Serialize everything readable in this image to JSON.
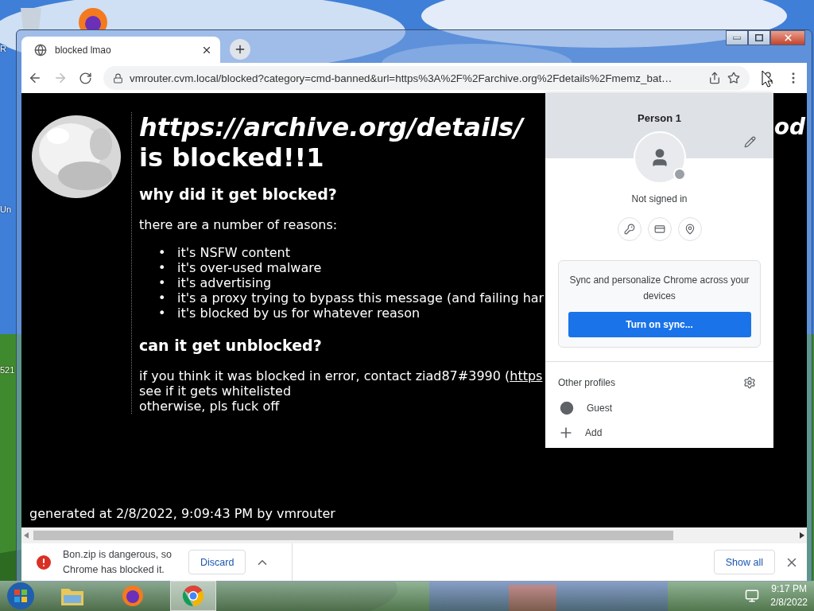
{
  "desktop": {
    "icon_labels": [
      "R",
      "Un",
      "521"
    ]
  },
  "browser": {
    "tabs": [
      {
        "title": "blocked lmao",
        "selected": true
      }
    ],
    "back_disabled": false,
    "forward_disabled": true,
    "address": "vmrouter.cvm.local/blocked?category=cmd-banned&url=https%3A%2F%2Farchive.org%2Fdetails%2Fmemz_bat…"
  },
  "page": {
    "heading_url": "https://archive.org/details/",
    "heading_url_tail": "od",
    "heading_rest": "is blocked!!1",
    "section_1": "why did it get blocked?",
    "intro": "there are a number of reasons:",
    "bullet": "•",
    "reasons": [
      "it's NSFW content",
      "it's over-used malware",
      "it's advertising",
      "it's a proxy trying to bypass this message (and failing har",
      "it's blocked by us for whatever reason"
    ],
    "section_2": "can it get unblocked?",
    "contact_text": "if you think it was blocked in error, contact ziad87#3990 (",
    "contact_link": "https",
    "lines": [
      "see if it gets whitelisted",
      "otherwise, pls fuck off"
    ],
    "footer": "generated at 2/8/2022, 9:09:43 PM by vmrouter"
  },
  "profile_menu": {
    "name": "Person 1",
    "status": "Not signed in",
    "sync_text": "Sync and personalize Chrome across your devices",
    "sync_button": "Turn on sync...",
    "other_profiles_label": "Other profiles",
    "profiles": [
      {
        "kind": "guest",
        "label": "Guest"
      },
      {
        "kind": "add",
        "label": "Add"
      }
    ]
  },
  "download_bar": {
    "message": "Bon.zip is dangerous, so Chrome has blocked it.",
    "discard": "Discard",
    "show_all": "Show all"
  },
  "taskbar": {
    "apps": [
      {
        "kind": "folder",
        "selected": false
      },
      {
        "kind": "fox",
        "selected": false
      },
      {
        "kind": "chrome",
        "selected": true
      }
    ],
    "time": "9:17 PM",
    "date": "2/8/2022"
  }
}
